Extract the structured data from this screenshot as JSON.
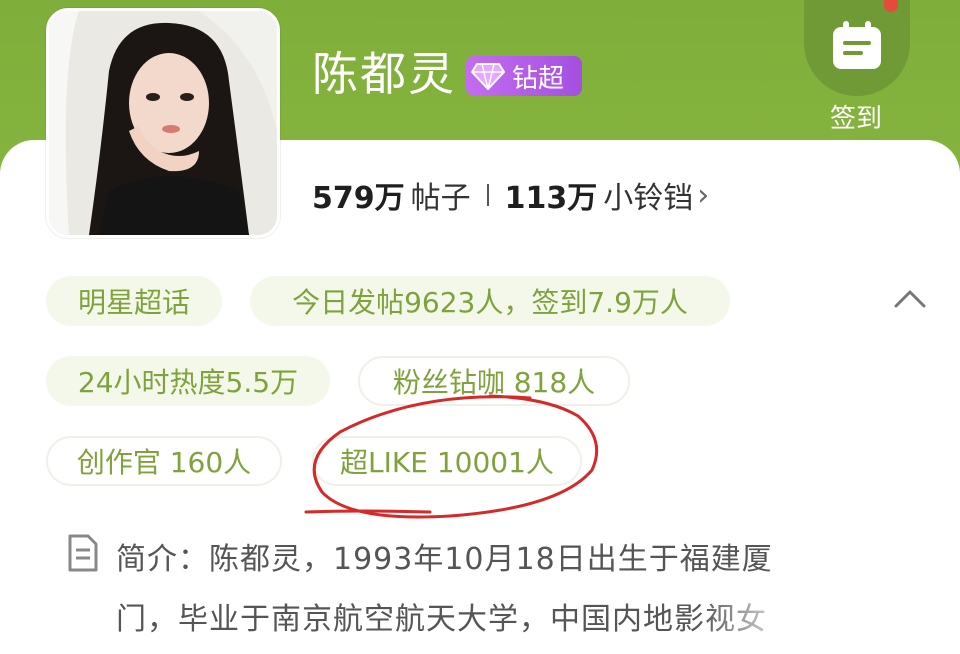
{
  "profile": {
    "name": "陈都灵",
    "badge_label": "钻超"
  },
  "signin": {
    "label": "签到"
  },
  "stats": {
    "posts_value": "579万",
    "posts_label": "帖子",
    "bells_value": "113万",
    "bells_label": "小铃铛",
    "chevron": "›"
  },
  "tags": {
    "category": "明星超话",
    "today": "今日发帖9623人，签到7.9万人",
    "heat": "24小时热度5.5万",
    "fans": "粉丝钻咖 818人",
    "creators": "创作官 160人",
    "super_like": "超LIKE 10001人"
  },
  "intro": {
    "line1": "简介：陈都灵，1993年10月18日出生于福建厦",
    "line2": "门，毕业于南京航空航天大学，中国内地影视女"
  },
  "colors": {
    "header_green": "#86b43f",
    "tag_text": "#7fa33c",
    "tag_bg": "#f4f8ea",
    "badge_purple": "#b35de8",
    "annotation_red": "#d42a2a"
  }
}
